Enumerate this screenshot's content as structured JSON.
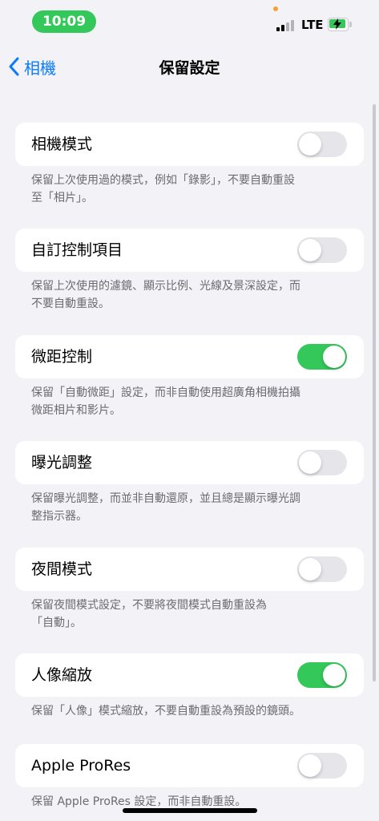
{
  "status_bar": {
    "time": "10:09",
    "network": "LTE",
    "battery_charging": true,
    "accent_color": "#34c759"
  },
  "nav": {
    "back_label": "相機",
    "title": "保留設定"
  },
  "settings": [
    {
      "label": "相機模式",
      "on": false,
      "footer": "保留上次使用過的模式，例如「錄影」，不要自動重設\n至「相片」。"
    },
    {
      "label": "自訂控制項目",
      "on": false,
      "footer": "保留上次使用的濾鏡、顯示比例、光線及景深設定，而\n不要自動重設。"
    },
    {
      "label": "微距控制",
      "on": true,
      "footer": "保留「自動微距」設定，而非自動使用超廣角相機拍攝\n微距相片和影片。"
    },
    {
      "label": "曝光調整",
      "on": false,
      "footer": "保留曝光調整，而並非自動還原，並且總是顯示曝光調\n整指示器。"
    },
    {
      "label": "夜間模式",
      "on": false,
      "footer": "保留夜間模式設定，不要將夜間模式自動重設為\n「自動」。"
    },
    {
      "label": "人像縮放",
      "on": true,
      "footer": "保留「人像」模式縮放，不要自動重設為預設的鏡頭。"
    },
    {
      "label": "Apple ProRes",
      "on": false,
      "footer": "保留 Apple ProRes 設定，而非自動重設。"
    }
  ],
  "colors": {
    "toggle_on": "#34c759",
    "toggle_off": "#e5e5ea",
    "link": "#0a7aff"
  }
}
